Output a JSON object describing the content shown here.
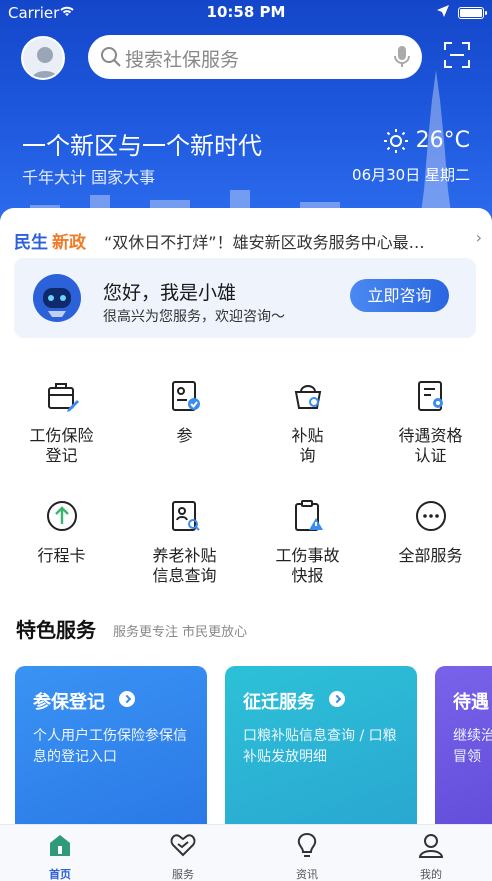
{
  "status_bar": {
    "carrier": "Carrier",
    "time": "10:58 PM"
  },
  "search": {
    "placeholder": "搜索社保服务"
  },
  "hero": {
    "slogan": "一个新区与一个新时代",
    "subslogan": "千年大计 国家大事",
    "temperature": "26°C",
    "date": "06月30日 星期二"
  },
  "news": {
    "tag_part1": "民生",
    "tag_part2": "新政",
    "headline": "“双休日不打烊”！雄安新区政务服务中心最…"
  },
  "assistant": {
    "greeting": "您好，我是小雄",
    "subtitle": "很高兴为您服务，欢迎咨询～",
    "button": "立即咨询"
  },
  "services": [
    {
      "label": "工伤保险\n登记",
      "icon": "briefcase-edit-icon"
    },
    {
      "label": "参",
      "icon": "id-card-check-icon"
    },
    {
      "label": "补贴\n询",
      "icon": "basket-search-icon"
    },
    {
      "label": "待遇资格\n认证",
      "icon": "certificate-icon"
    },
    {
      "label": "行程卡",
      "icon": "arrow-up-circle-icon"
    },
    {
      "label": "养老补贴\n信息查询",
      "icon": "profile-search-icon"
    },
    {
      "label": "工伤事故\n快报",
      "icon": "clipboard-warning-icon"
    },
    {
      "label": "全部服务",
      "icon": "more-circle-icon"
    }
  ],
  "featured": {
    "title": "特色服务",
    "subtitle": "服务更专注 市民更放心",
    "cards": [
      {
        "title": "参保登记",
        "desc": "个人用户工伤保险参保信息的登记入口",
        "color": "#2f86ee"
      },
      {
        "title": "征迁服务",
        "desc": "口粮补贴信息查询 / 口粮补贴发放明细",
        "color": "#2bbad6"
      },
      {
        "title": "待遇",
        "desc": "继续治遇冒领",
        "color": "#6a55e0"
      }
    ]
  },
  "tabs": [
    {
      "label": "首页",
      "icon": "home-icon"
    },
    {
      "label": "服务",
      "icon": "heart-icon"
    },
    {
      "label": "资讯",
      "icon": "lightbulb-icon"
    },
    {
      "label": "我的",
      "icon": "user-icon"
    }
  ],
  "colors": {
    "primary": "#2b62d9",
    "accent_orange": "#f07c2a",
    "hero_blue": "#1d57dc"
  }
}
